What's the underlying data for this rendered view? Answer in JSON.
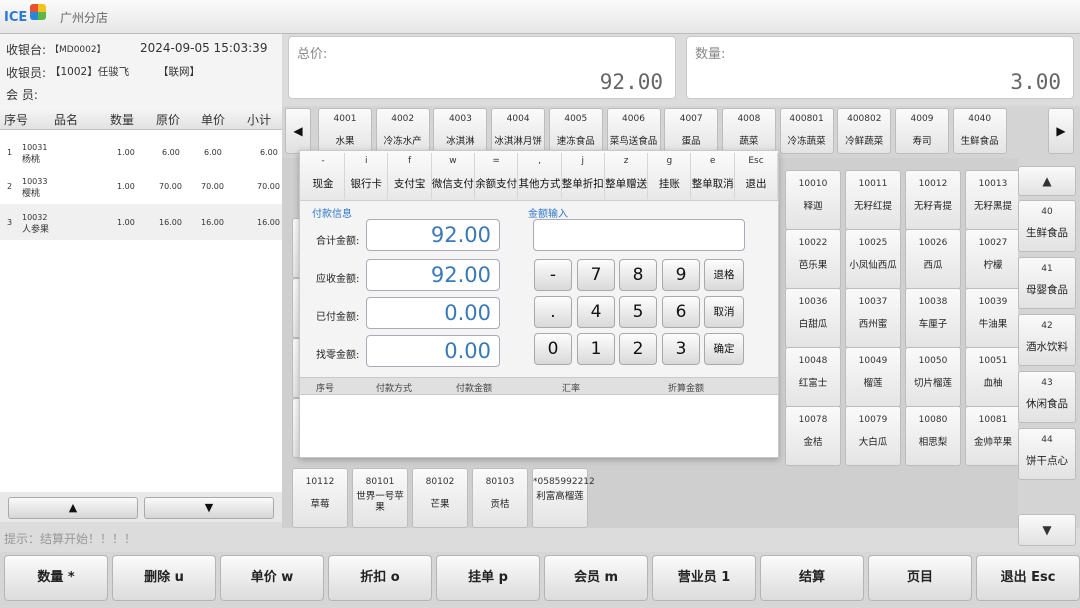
{
  "app": {
    "logo": "ICE",
    "store": "广州分店"
  },
  "info": {
    "cashier_label": "收银台:",
    "cashier_value": "【MD0002】",
    "datetime": "2024-09-05 15:03:39",
    "operator_label": "收银员:",
    "operator_value": "【1002】任骏飞",
    "network": "【联网】",
    "member_label": "会 员:"
  },
  "totals": {
    "total_label": "总价:",
    "total_value": "92.00",
    "qty_label": "数量:",
    "qty_value": "3.00"
  },
  "list": {
    "headers": [
      "序号",
      "品名",
      "数量",
      "原价",
      "单价",
      "小计"
    ],
    "rows": [
      {
        "no": "1",
        "code": "10031",
        "name": "杨桃",
        "qty": "1.00",
        "orig": "6.00",
        "price": "6.00",
        "subtotal": "6.00"
      },
      {
        "no": "2",
        "code": "10033",
        "name": "樱桃",
        "qty": "1.00",
        "orig": "70.00",
        "price": "70.00",
        "subtotal": "70.00"
      },
      {
        "no": "3",
        "code": "10032",
        "name": "人参果",
        "qty": "1.00",
        "orig": "16.00",
        "price": "16.00",
        "subtotal": "16.00"
      }
    ],
    "nav_up": "▲",
    "nav_down": "▼",
    "hint": "提示：结算开始！！！！"
  },
  "categories": [
    {
      "code": "4001",
      "name": "水果"
    },
    {
      "code": "4002",
      "name": "冷冻水产"
    },
    {
      "code": "4003",
      "name": "冰淇淋"
    },
    {
      "code": "4004",
      "name": "冰淇淋月饼"
    },
    {
      "code": "4005",
      "name": "速冻食品"
    },
    {
      "code": "4006",
      "name": "菜鸟送食品"
    },
    {
      "code": "4007",
      "name": "蛋品"
    },
    {
      "code": "4008",
      "name": "蔬菜"
    },
    {
      "code": "400801",
      "name": "冷冻蔬菜"
    },
    {
      "code": "400802",
      "name": "冷鲜蔬菜"
    },
    {
      "code": "4009",
      "name": "寿司"
    },
    {
      "code": "4040",
      "name": "生鲜食品"
    }
  ],
  "cat_prev": "◀",
  "cat_next": "▶",
  "products": [
    {
      "code": "10010",
      "name": "释迦"
    },
    {
      "code": "10011",
      "name": "无籽红提"
    },
    {
      "code": "10012",
      "name": "无籽青提"
    },
    {
      "code": "10013",
      "name": "无籽黑提"
    },
    {
      "code": "10022",
      "name": "芭乐果"
    },
    {
      "code": "10025",
      "name": "小凤仙西瓜"
    },
    {
      "code": "10026",
      "name": "西瓜"
    },
    {
      "code": "10027",
      "name": "柠檬"
    },
    {
      "code": "10036",
      "name": "白甜瓜"
    },
    {
      "code": "10037",
      "name": "西州蜜"
    },
    {
      "code": "10038",
      "name": "车厘子"
    },
    {
      "code": "10039",
      "name": "牛油果"
    },
    {
      "code": "10048",
      "name": "红富士"
    },
    {
      "code": "10049",
      "name": "榴莲"
    },
    {
      "code": "10050",
      "name": "切片榴莲"
    },
    {
      "code": "10051",
      "name": "血柚"
    },
    {
      "code": "10078",
      "name": "金桔"
    },
    {
      "code": "10079",
      "name": "大白瓜"
    },
    {
      "code": "10080",
      "name": "相思梨"
    },
    {
      "code": "10081",
      "name": "金帅苹果"
    }
  ],
  "bottom_products": [
    {
      "code": "10112",
      "name": "草莓"
    },
    {
      "code": "80101",
      "name": "世界一号苹果"
    },
    {
      "code": "80102",
      "name": "芒果"
    },
    {
      "code": "80103",
      "name": "贡桔"
    },
    {
      "code": "*0585992212",
      "name": "利富高榴莲"
    }
  ],
  "side_categories": [
    {
      "code": "40",
      "name": "生鲜食品"
    },
    {
      "code": "41",
      "name": "母婴食品"
    },
    {
      "code": "42",
      "name": "酒水饮料"
    },
    {
      "code": "43",
      "name": "休闲食品"
    },
    {
      "code": "44",
      "name": "饼干点心"
    }
  ],
  "side_up": "▲",
  "side_down": "▼",
  "bottom_buttons": [
    "数量 *",
    "删除 u",
    "单价 w",
    "折扣 o",
    "挂单 p",
    "会员 m",
    "营业员 1",
    "结算",
    "页目",
    "退出 Esc"
  ],
  "dialog": {
    "toolbar": [
      {
        "key": "-",
        "name": "现金"
      },
      {
        "key": "i",
        "name": "银行卡"
      },
      {
        "key": "f",
        "name": "支付宝"
      },
      {
        "key": "w",
        "name": "微信支付"
      },
      {
        "key": "=",
        "name": "余额支付"
      },
      {
        "key": ",",
        "name": "其他方式"
      },
      {
        "key": "j",
        "name": "整单折扣"
      },
      {
        "key": "z",
        "name": "整单赠送"
      },
      {
        "key": "g",
        "name": "挂账"
      },
      {
        "key": "e",
        "name": "整单取消"
      },
      {
        "key": "Esc",
        "name": "退出"
      }
    ],
    "pay_info_title": "付款信息",
    "amount_input_title": "金额输入",
    "total_label": "合计金额:",
    "total_value": "92.00",
    "due_label": "应收金额:",
    "due_value": "92.00",
    "paid_label": "已付金额:",
    "paid_value": "0.00",
    "change_label": "找零金额:",
    "change_value": "0.00",
    "input_value": "",
    "keypad": {
      "minus": "-",
      "dot": ".",
      "k0": "0",
      "k1": "1",
      "k2": "2",
      "k3": "3",
      "k4": "4",
      "k5": "5",
      "k6": "6",
      "k7": "7",
      "k8": "8",
      "k9": "9",
      "backspace": "退格",
      "cancel": "取消",
      "confirm": "确定"
    },
    "pay_headers": [
      "序号",
      "付款方式",
      "付款金额",
      "汇率",
      "折算金额"
    ]
  },
  "colors": {
    "accent_blue": "#3a79b8",
    "section_blue": "#2e77c9"
  }
}
